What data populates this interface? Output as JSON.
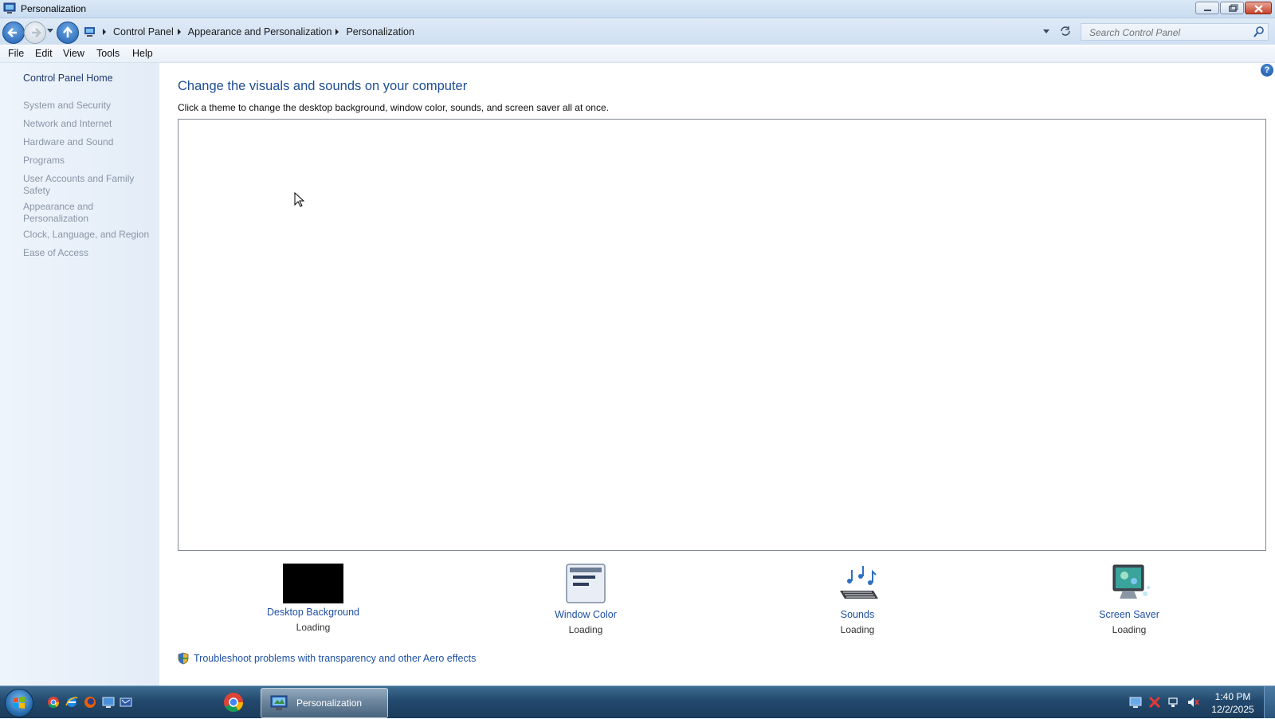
{
  "window": {
    "title": "Personalization"
  },
  "address_bar": {
    "breadcrumbs": [
      "Control Panel",
      "Appearance and Personalization",
      "Personalization"
    ],
    "search_placeholder": "Search Control Panel"
  },
  "menu": {
    "items": [
      "File",
      "Edit",
      "View",
      "Tools",
      "Help"
    ]
  },
  "sidebar": {
    "home": "Control Panel Home",
    "items": [
      "System and Security",
      "Network and Internet",
      "Hardware and Sound",
      "Programs",
      "User Accounts and Family Safety",
      "Appearance and Personalization",
      "Clock, Language, and Region",
      "Ease of Access"
    ]
  },
  "main": {
    "title": "Change the visuals and sounds on your computer",
    "description": "Click a theme to change the desktop background, window color, sounds, and screen saver all at once.",
    "tiles": [
      {
        "label": "Desktop Background",
        "status": "Loading"
      },
      {
        "label": "Window Color",
        "status": "Loading"
      },
      {
        "label": "Sounds",
        "status": "Loading"
      },
      {
        "label": "Screen Saver",
        "status": "Loading"
      }
    ],
    "troubleshoot_link": "Troubleshoot problems with transparency and other Aero effects"
  },
  "taskbar": {
    "active_window": "Personalization",
    "clock_time": "1:40 PM",
    "clock_date": "12/2/2025"
  },
  "colors": {
    "link_blue": "#1e50a2",
    "title_blue": "#1e4e96",
    "sidebar_bg": "#e9f1fa",
    "taskbar_bg": "#22496d"
  }
}
